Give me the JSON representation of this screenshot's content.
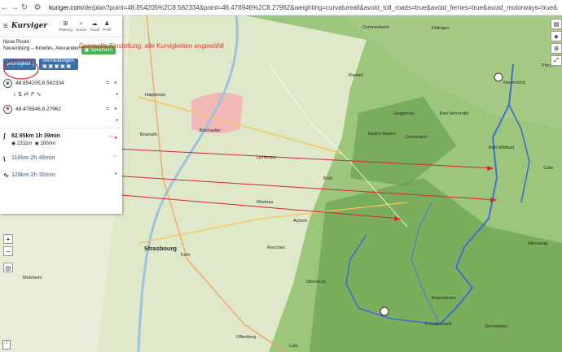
{
  "browser": {
    "url_prefix": "kuriger.com",
    "url_rest": "/de/plan?point=48.854205%2C8.582334&point=48.478946%2C8.27962&weighting=curvatureall&avoid_toll_roads=true&avoid_ferries=true&avoid_motorways=true&avoid_main_roads=true&document_..."
  },
  "header": {
    "logo": "Kurviger",
    "tabs": [
      {
        "icon": "⊞",
        "label": "Planung"
      },
      {
        "icon": "⌕",
        "label": "Suche"
      },
      {
        "icon": "☁",
        "label": "Cloud"
      },
      {
        "icon": "♟",
        "label": "Profil"
      }
    ]
  },
  "route": {
    "title": "Neue Route",
    "name": "Neuenbürg – Kniebis, Alexanders...",
    "save_label": "Speichern"
  },
  "modes": {
    "kurvigkeit_label": "Kurvigkeit",
    "vermeidungen_label": "Vermeidungen",
    "vermeidungen_icons": "▣ ▣ ▣ ▣ ▣"
  },
  "waypoints": [
    {
      "value": "48.854205,8.582334",
      "icon": "◉"
    },
    {
      "value": "48.478946,8.27962",
      "icon": "⚑"
    }
  ],
  "toolbar_icons": "↕  ⇅  ⇄  ↱  ∿",
  "alternatives": [
    {
      "symbol": "ʃ",
      "summary": "82.95km 1h 39min",
      "detail1": "2332m",
      "detail2": "1800m",
      "badge": "◠ ●"
    },
    {
      "symbol": "ʅ",
      "summary": "116km 2h 49min",
      "badge": "◠"
    },
    {
      "symbol": "∿",
      "summary": "128km 2h 30min",
      "badge": "●"
    }
  ],
  "annotation": "Generelle Einstellung, alle Kurvigkeiten angewählt",
  "map": {
    "places": [
      {
        "name": "Rastatt"
      },
      {
        "name": "Baden-Baden"
      },
      {
        "name": "Gernsbach"
      },
      {
        "name": "Bad Herrenalb"
      },
      {
        "name": "Neuenbürg"
      },
      {
        "name": "Bad Wildbad"
      },
      {
        "name": "Bühl"
      },
      {
        "name": "Achern"
      },
      {
        "name": "Strasbourg"
      },
      {
        "name": "Kehl"
      },
      {
        "name": "Offenburg"
      },
      {
        "name": "Oberkirch"
      },
      {
        "name": "Freudenstadt"
      },
      {
        "name": "Baiersbronn"
      },
      {
        "name": "Lahr"
      },
      {
        "name": "Pforzh"
      },
      {
        "name": "Durmersheim"
      },
      {
        "name": "Ettlingen"
      },
      {
        "name": "Bischwiller"
      },
      {
        "name": "Brumath"
      },
      {
        "name": "Haguenau"
      },
      {
        "name": "Altensteig"
      },
      {
        "name": "Dornstetten"
      },
      {
        "name": "Molsheim"
      },
      {
        "name": "Rheinau"
      },
      {
        "name": "Lichtenau"
      },
      {
        "name": "Renchen"
      },
      {
        "name": "Gaggenau"
      },
      {
        "name": "Calw"
      }
    ]
  }
}
